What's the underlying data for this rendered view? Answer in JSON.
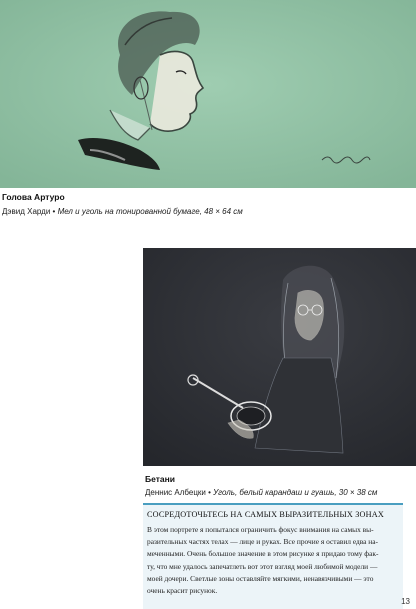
{
  "artwork_1": {
    "title": "Голова Артуро",
    "artist": "Дэвид Харди",
    "separator": "•",
    "description": "Мел и уголь на тонированной бумаге, 48 × 64 см"
  },
  "artwork_2": {
    "title": "Бетани",
    "artist": "Деннис Албецки",
    "separator": "•",
    "description": "Уголь, белый карандаш и гуашь, 30 × 38 см"
  },
  "sidebar": {
    "heading": "СОСРЕДОТОЧЬТЕСЬ НА САМЫХ ВЫРАЗИТЕЛЬНЫХ ЗОНАХ",
    "lines": [
      "В этом портрете я попытался ограничить фокус внимания на самых вы-",
      "разительных частях телах — лице и руках. Все прочие я оставил едва на-",
      "меченными. Очень большое значение в этом рисунке я придаю тому фак-",
      "ту, что мне удалось запечатлеть вот этот взгляд моей любимой модели —",
      "моей дочери. Светлые зоны оставляйте мягкими, ненавязчивыми — это",
      "очень красит рисунок."
    ]
  },
  "page_number": "13",
  "colors": {
    "paper_green": "#8fc0a3",
    "paper_dark": "#2e3035",
    "accent_blue": "#4a9ec0",
    "sidebar_bg": "#ecf4f8"
  }
}
